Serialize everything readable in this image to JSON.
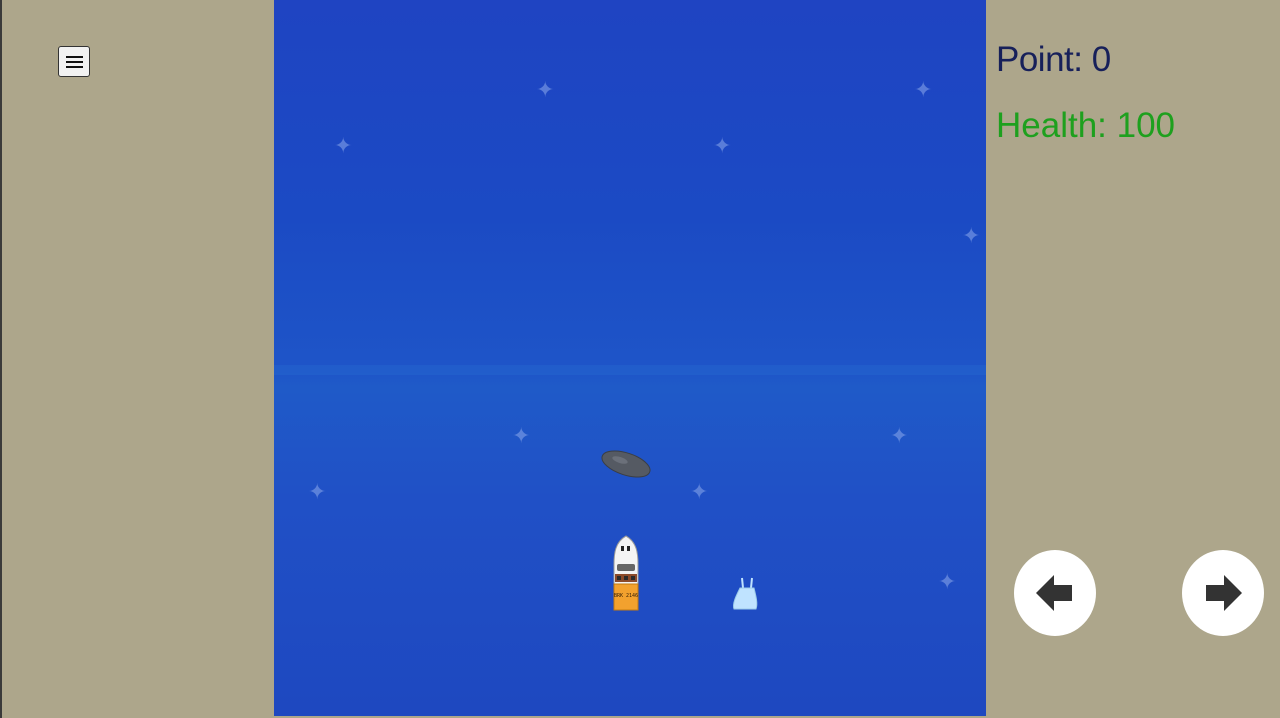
{
  "hud": {
    "point_label": "Point: 0",
    "health_label": "Health: 100"
  },
  "controls": {
    "menu_icon": "hamburger-menu-icon",
    "left_icon": "arrow-left-icon",
    "right_icon": "arrow-right-icon"
  },
  "colors": {
    "sand": "#ada68b",
    "water": "#1f4cc4",
    "point_text": "#17205a",
    "health_text": "#1ea01e",
    "button_bg": "#ffffff",
    "arrow": "#333333"
  },
  "boat": {
    "plate_text": "BRK 2146"
  }
}
